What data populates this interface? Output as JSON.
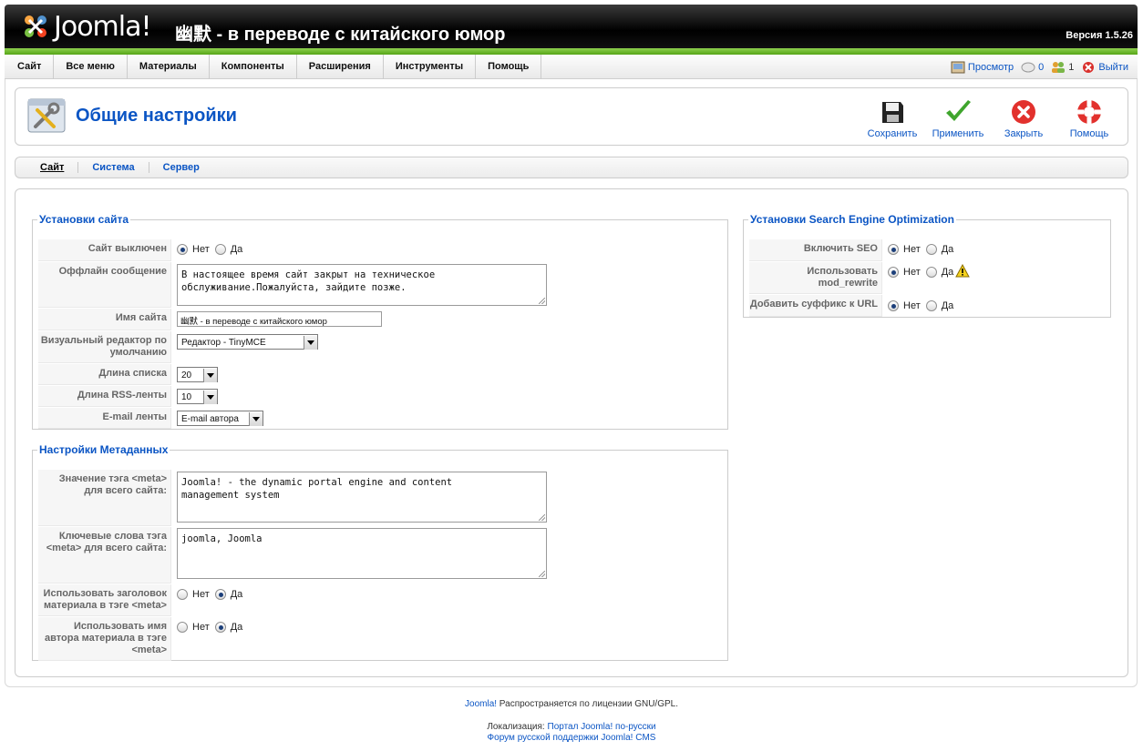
{
  "header": {
    "logo_text": "Joomla!",
    "site_title": "幽默 - в переводе с китайского юмор",
    "version": "Версия 1.5.26"
  },
  "menu": [
    "Сайт",
    "Все меню",
    "Материалы",
    "Компоненты",
    "Расширения",
    "Инструменты",
    "Помощь"
  ],
  "status": {
    "preview": "Просмотр",
    "messages": "0",
    "users": "1",
    "logout": "Выйти"
  },
  "page": {
    "title": "Общие настройки"
  },
  "toolbar": {
    "save": "Сохранить",
    "apply": "Применить",
    "close": "Закрыть",
    "help": "Помощь"
  },
  "tabs": [
    "Сайт",
    "Система",
    "Сервер"
  ],
  "site_settings": {
    "legend": "Установки сайта",
    "offline_label": "Сайт выключен",
    "offline_message_label": "Оффлайн сообщение",
    "offline_message_value": "В настоящее время сайт закрыт на техническое\nобслуживание.Пожалуйста, зайдите позже.",
    "sitename_label": "Имя сайта",
    "sitename_value": "幽默 - в переводе с китайского юмор",
    "editor_label": "Визуальный редактор по умолчанию",
    "editor_value": "Редактор - TinyMCE",
    "list_length_label": "Длина списка",
    "list_length_value": "20",
    "rss_length_label": "Длина RSS-ленты",
    "rss_length_value": "10",
    "feed_email_label": "E-mail ленты",
    "feed_email_value": "E-mail автора"
  },
  "metadata": {
    "legend": "Настройки Метаданных",
    "description_label": "Значение тэга <meta> для всего сайта:",
    "description_value": "Joomla! - the dynamic portal engine and content\nmanagement system",
    "keywords_label": "Ключевые слова тэга <meta> для всего сайта:",
    "keywords_value": "joomla, Joomla",
    "title_in_meta_label": "Использовать заголовок материала в тэге <meta>",
    "author_in_meta_label": "Использовать имя автора материала в тэге <meta>"
  },
  "seo": {
    "legend": "Установки Search Engine Optimization",
    "enable_label": "Включить SEO",
    "mod_rewrite_label": "Использовать mod_rewrite",
    "suffix_label": "Добавить суффикс к URL"
  },
  "radio": {
    "no": "Нет",
    "yes": "Да"
  },
  "footer": {
    "joomla_link": "Joomla!",
    "license_text": " Распространяется по лицензии GNU/GPL.",
    "localization_label": "Локализация: ",
    "portal_link": "Портал Joomla! по-русски",
    "forum_link": "Форум русской поддержки Joomla! CMS"
  },
  "colors": {
    "link_blue": "#0B55C4",
    "header_bg": "#000000",
    "accent_green": "#56A517"
  }
}
